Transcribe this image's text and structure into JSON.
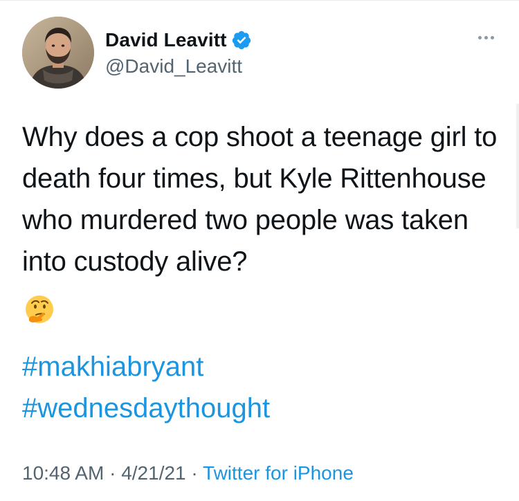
{
  "author": {
    "display_name": "David Leavitt",
    "handle": "@David_Leavitt",
    "verified": true,
    "verified_color": "#1d9bf0"
  },
  "tweet": {
    "text": "Why does a cop shoot a teenage girl to death four times, but Kyle Rittenhouse who murdered two people was taken into custody alive?",
    "emoji": "thinking-face",
    "hashtags": [
      "#makhiabryant",
      "#wednesdaythought"
    ]
  },
  "meta": {
    "time": "10:48 AM",
    "separator": "·",
    "date": "4/21/21",
    "source": "Twitter for iPhone"
  },
  "colors": {
    "link": "#1b95e0",
    "secondary_text": "#536471",
    "primary_text": "#0f1419"
  },
  "icons": {
    "more": "more-horizontal-icon",
    "verified": "verified-badge-icon"
  }
}
